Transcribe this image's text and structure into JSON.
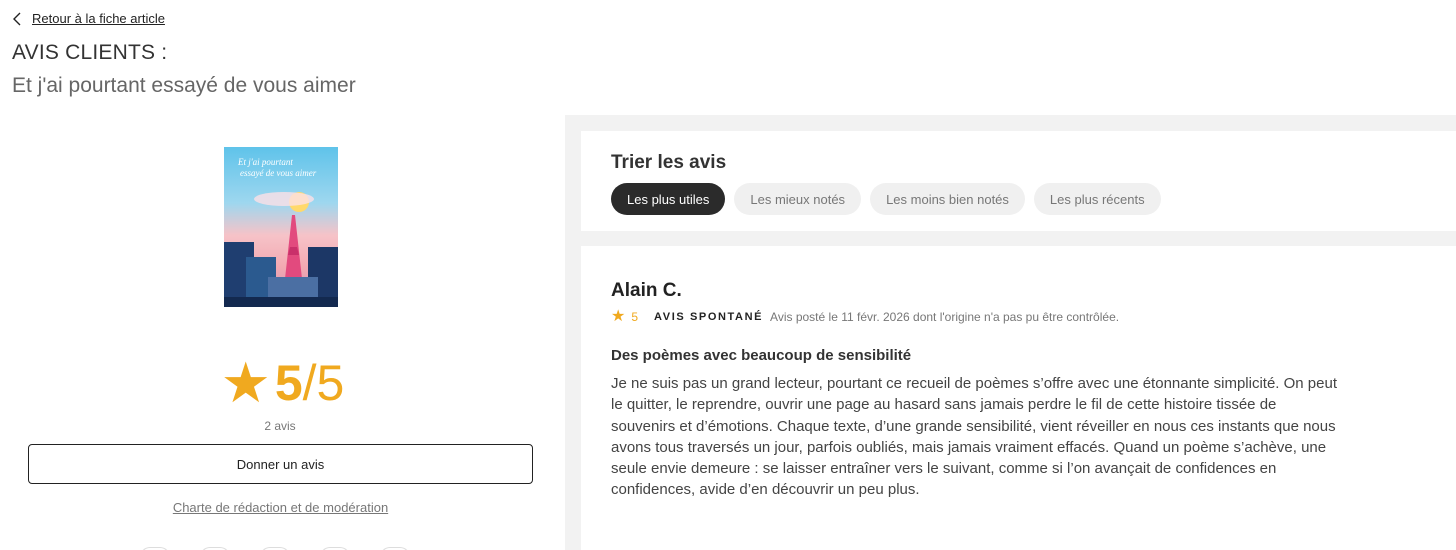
{
  "header": {
    "back_label": "Retour à la fiche article",
    "title": "AVIS CLIENTS :",
    "subtitle": "Et j'ai pourtant essayé de vous aimer"
  },
  "product": {
    "cover_title_line1": "Et j'ai pourtant",
    "cover_title_line2": "essayé de vous aimer",
    "rating_star": "★",
    "rating_score": "5",
    "rating_outof": "/5",
    "review_count": "2 avis",
    "give_review_label": "Donner un avis",
    "charter_label": "Charte de rédaction et de modération"
  },
  "sort": {
    "title": "Trier les avis",
    "tabs": [
      {
        "label": "Les plus utiles",
        "active": true
      },
      {
        "label": "Les mieux notés",
        "active": false
      },
      {
        "label": "Les moins bien notés",
        "active": false
      },
      {
        "label": "Les plus récents",
        "active": false
      }
    ]
  },
  "review": {
    "author": "Alain C.",
    "star": "★",
    "rating": "5",
    "badge": "AVIS SPONTANÉ",
    "posted": "Avis posté le 11 févr. 2026 dont l'origine n'a pas pu être contrôlée.",
    "title": "Des poèmes avec beaucoup de sensibilité",
    "body": "Je ne suis pas un grand lecteur, pourtant ce recueil de poèmes s’offre avec une étonnante simplicité. On peut le quitter, le reprendre, ouvrir une page au hasard sans jamais perdre le fil de cette histoire tissée de souvenirs et d’émotions. Chaque texte, d’une grande sensibilité, vient réveiller en nous ces instants que nous avons tous traversés un jour, parfois oubliés, mais jamais vraiment effacés. Quand un poème s’achève, une seule envie demeure : se laisser entraîner vers le suivant, comme si l’on avançait de confidences en confidences, avide d’en découvrir un peu plus."
  },
  "colors": {
    "accent_star": "#f0a91f",
    "active_tab": "#2b2b2b",
    "panel_bg": "#f2f2f2"
  }
}
